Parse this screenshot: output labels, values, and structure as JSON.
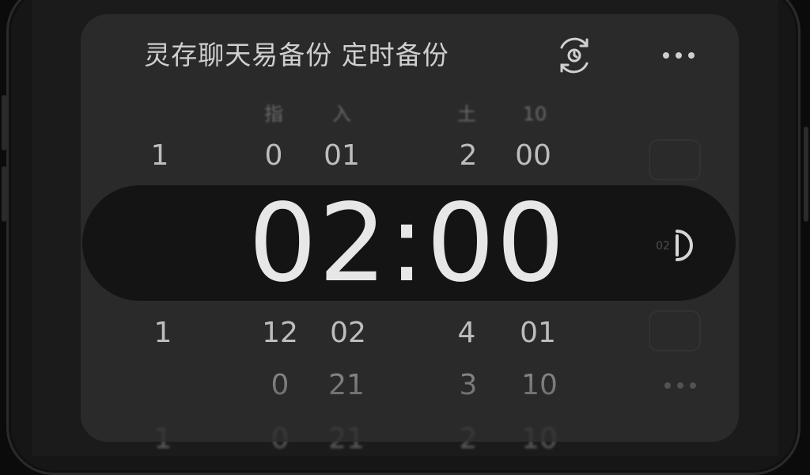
{
  "header": {
    "title": "灵存聊天易备份 定时备份",
    "sync_icon": "sync-clock-icon",
    "more_icon": "more-dots-icon"
  },
  "picker": {
    "top_labels_partial": [
      "指",
      "入",
      "土",
      "10"
    ],
    "row_above": [
      "1",
      "0",
      "01",
      "2",
      "00"
    ],
    "selected_time": "02:00",
    "row_below_1": [
      "1",
      "12",
      "02",
      "4",
      "01"
    ],
    "row_below_2": [
      "0",
      "21",
      "3",
      "10"
    ],
    "row_below_3_partial": [
      "1",
      "0",
      "21",
      "2",
      "10"
    ]
  },
  "side": {
    "small_label_02": "02"
  },
  "colors": {
    "background": "#0b0b0c",
    "card": "#2a2a2b",
    "selection_band": "#141414",
    "text_primary": "#e7e7e7",
    "text_secondary": "#bdbdbd"
  }
}
